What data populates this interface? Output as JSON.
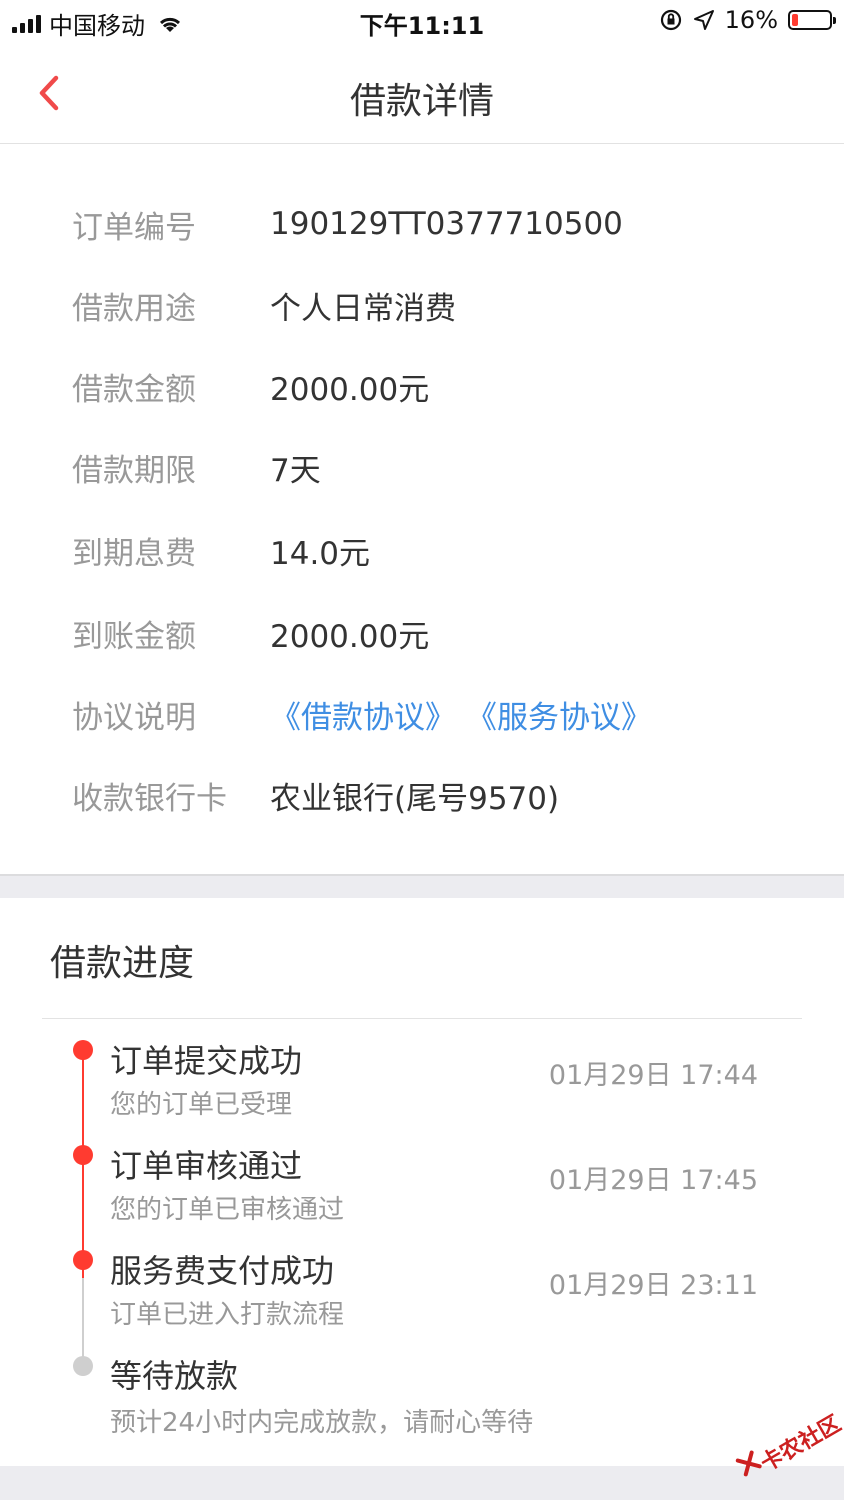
{
  "status_bar": {
    "carrier": "中国移动",
    "time": "下午11:11",
    "battery": "16%",
    "battery_level": 0.16,
    "icons": [
      "signal-icon",
      "wifi-icon",
      "orientation-lock-icon",
      "location-icon",
      "battery-icon"
    ]
  },
  "nav": {
    "title": "借款详情",
    "back_icon": "chevron-left-icon",
    "accent": "#f04a4a"
  },
  "details": {
    "order_no": {
      "label": "订单编号",
      "value": "190129TT0377710500"
    },
    "purpose": {
      "label": "借款用途",
      "value": "个人日常消费"
    },
    "amount": {
      "label": "借款金额",
      "value": "2000.00元"
    },
    "term": {
      "label": "借款期限",
      "value": "7天"
    },
    "fee": {
      "label": "到期息费",
      "value": "14.0元"
    },
    "received": {
      "label": "到账金额",
      "value": "2000.00元"
    },
    "agreement": {
      "label": "协议说明",
      "link1": "《借款协议》",
      "link2": "《服务协议》",
      "link_color": "#3f8ee3"
    },
    "bank_card": {
      "label": "收款银行卡",
      "value": "农业银行(尾号9570)"
    }
  },
  "progress": {
    "title": "借款进度",
    "steps": [
      {
        "title": "订单提交成功",
        "sub": "您的订单已受理",
        "time": "01月29日 17:44",
        "done": true
      },
      {
        "title": "订单审核通过",
        "sub": "您的订单已审核通过",
        "time": "01月29日 17:45",
        "done": true
      },
      {
        "title": "服务费支付成功",
        "sub": "订单已进入打款流程",
        "time": "01月29日 23:11",
        "done": true
      },
      {
        "title": "等待放款",
        "sub": "预计24小时内完成放款，请耐心等待",
        "time": "",
        "done": false
      }
    ],
    "done_color": "#ff3b30",
    "pending_color": "#cfcfcf"
  },
  "watermark": {
    "text": "卡农社区"
  }
}
